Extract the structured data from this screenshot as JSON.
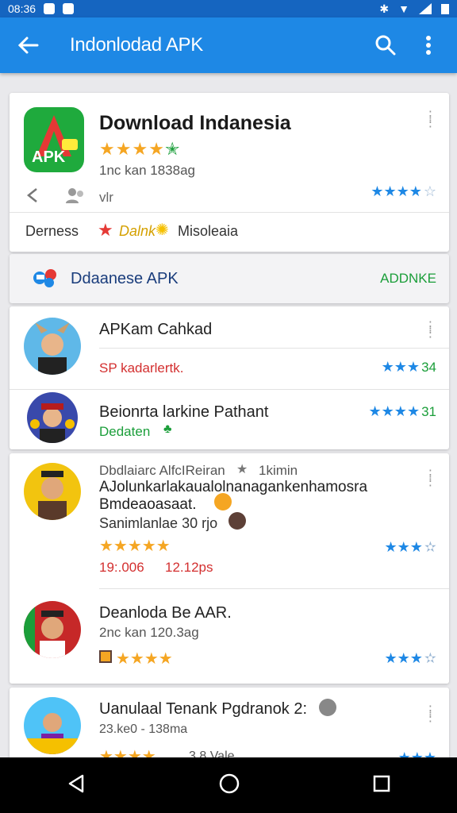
{
  "status_bar": {
    "time": "08:36"
  },
  "app_bar": {
    "title": "Indonlodad APK"
  },
  "hero": {
    "title": "Download Indanesia",
    "meta": "1nc kan 1838ag",
    "action_text": "vlr",
    "tag_left": "Derness",
    "tag_mid": "Dalnk",
    "tag_right": "Misoleaia",
    "icon_text": "APK"
  },
  "sub_card": {
    "label": "Ddaanese APK",
    "action": "ADDNKE"
  },
  "list1": [
    {
      "title": "APKam Cahkad",
      "sub": "SP kadarlertk.",
      "sub_color": "#d32f2f",
      "rating": "34"
    },
    {
      "title": "Beionrta larkine Pathant",
      "sub": "Dedaten",
      "sub_color": "#1b9e3a",
      "rating": "31"
    }
  ],
  "list2_item1": {
    "line1": "Dbdlaiarc AlfcIReiran",
    "line1b": "1kimin",
    "line2": "AJolunkarlakaualolnanagankenhamosra",
    "line3": "Bmdeaoasaat.",
    "line4": "Sanimlanlae 30 rjo",
    "stat_left": "19:.006",
    "stat_right": "12.12ps"
  },
  "list2_item2": {
    "title": "Deanloda Be AAR.",
    "meta": "2nc kan 120.3ag"
  },
  "list3_item1": {
    "title": "Uanulaal Tenank Pgdranok 2:",
    "meta": "23.ke0 - 138ma",
    "meta2": "3.8 Vale"
  },
  "colors": {
    "primary": "#1e88e5",
    "status": "#1565c0",
    "green": "#1b9e3a",
    "star_gold": "#f5a623",
    "star_blue": "#1e88e5"
  }
}
